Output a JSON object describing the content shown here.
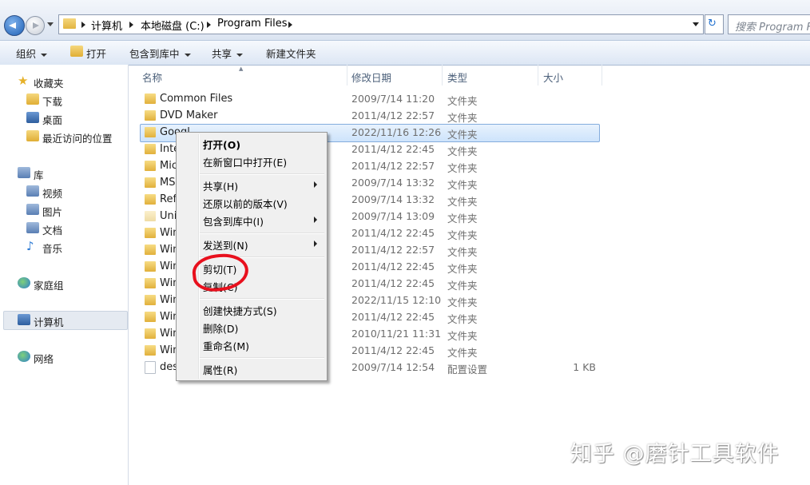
{
  "address": {
    "breadcrumbs": [
      "计算机",
      "本地磁盘 (C:)",
      "Program Files"
    ],
    "search_placeholder": "搜索 Program Files"
  },
  "toolbar": {
    "organize": "组织",
    "open": "打开",
    "include_in_library": "包含到库中",
    "share": "共享",
    "new_folder": "新建文件夹"
  },
  "sidebar": {
    "favorites": "收藏夹",
    "downloads": "下载",
    "desktop": "桌面",
    "recent": "最近访问的位置",
    "libraries": "库",
    "videos": "视频",
    "pictures": "图片",
    "documents": "文档",
    "music": "音乐",
    "homegroup": "家庭组",
    "computer": "计算机",
    "network": "网络"
  },
  "columns": {
    "name": "名称",
    "modified": "修改日期",
    "type": "类型",
    "size": "大小"
  },
  "files": [
    {
      "name": "Common Files",
      "date": "2009/7/14 11:20",
      "type": "文件夹",
      "size": ""
    },
    {
      "name": "DVD Maker",
      "date": "2011/4/12 22:57",
      "type": "文件夹",
      "size": ""
    },
    {
      "name": "Googl",
      "date": "2022/11/16 12:26",
      "type": "文件夹",
      "size": ""
    },
    {
      "name": "Inte",
      "date": "2011/4/12 22:45",
      "type": "文件夹",
      "size": ""
    },
    {
      "name": "Mic",
      "date": "2011/4/12 22:57",
      "type": "文件夹",
      "size": ""
    },
    {
      "name": "MS",
      "date": "2009/7/14 13:32",
      "type": "文件夹",
      "size": ""
    },
    {
      "name": "Ref",
      "date": "2009/7/14 13:32",
      "type": "文件夹",
      "size": ""
    },
    {
      "name": "Uni",
      "date": "2009/7/14 13:09",
      "type": "文件夹",
      "size": ""
    },
    {
      "name": "Win",
      "date": "2011/4/12 22:45",
      "type": "文件夹",
      "size": ""
    },
    {
      "name": "Win",
      "date": "2011/4/12 22:57",
      "type": "文件夹",
      "size": ""
    },
    {
      "name": "Win",
      "date": "2011/4/12 22:45",
      "type": "文件夹",
      "size": ""
    },
    {
      "name": "Win",
      "date": "2011/4/12 22:45",
      "type": "文件夹",
      "size": ""
    },
    {
      "name": "Win",
      "date": "2022/11/15 12:10",
      "type": "文件夹",
      "size": ""
    },
    {
      "name": "Win",
      "date": "2011/4/12 22:45",
      "type": "文件夹",
      "size": ""
    },
    {
      "name": "Win",
      "date": "2010/11/21 11:31",
      "type": "文件夹",
      "size": ""
    },
    {
      "name": "Win",
      "date": "2011/4/12 22:45",
      "type": "文件夹",
      "size": ""
    },
    {
      "name": "des",
      "date": "2009/7/14 12:54",
      "type": "配置设置",
      "size": "1 KB"
    }
  ],
  "context_menu": {
    "open": "打开(O)",
    "open_new_window": "在新窗口中打开(E)",
    "share": "共享(H)",
    "restore": "还原以前的版本(V)",
    "include_library": "包含到库中(I)",
    "send_to": "发送到(N)",
    "cut": "剪切(T)",
    "copy": "复制(C)",
    "create_shortcut": "创建快捷方式(S)",
    "delete": "删除(D)",
    "rename": "重命名(M)",
    "properties": "属性(R)"
  },
  "watermark": "知乎 @磨针工具软件",
  "colors": {
    "selection": "#cde3fb",
    "annotation_red": "#e8101d"
  }
}
